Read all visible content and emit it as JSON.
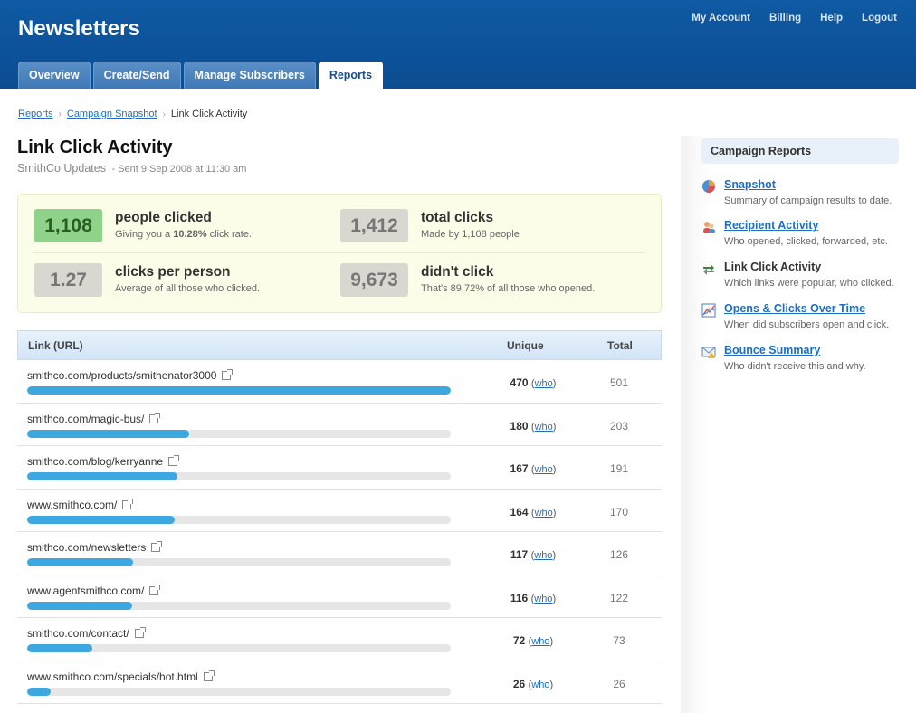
{
  "header": {
    "app_title": "Newsletters",
    "links": [
      "My Account",
      "Billing",
      "Help",
      "Logout"
    ],
    "tabs": [
      "Overview",
      "Create/Send",
      "Manage Subscribers",
      "Reports"
    ],
    "active_tab": "Reports"
  },
  "breadcrumb": {
    "items": [
      "Reports",
      "Campaign Snapshot"
    ],
    "current": "Link Click Activity"
  },
  "page": {
    "title": "Link Click Activity",
    "campaign": "SmithCo Updates",
    "sent": "- Sent 9 Sep 2008 at 11:30 am"
  },
  "stats": {
    "people_clicked": {
      "value": "1,108",
      "label": "people clicked",
      "desc_pre": "Giving you a ",
      "desc_bold": "10.28%",
      "desc_post": " click rate."
    },
    "total_clicks": {
      "value": "1,412",
      "label": "total clicks",
      "desc": "Made by 1,108 people"
    },
    "clicks_per_person": {
      "value": "1.27",
      "label": "clicks per person",
      "desc": "Average of all those who clicked."
    },
    "didnt_click": {
      "value": "9,673",
      "label": "didn't click",
      "desc": "That's 89.72% of all those who opened."
    }
  },
  "table": {
    "headers": {
      "link": "Link (URL)",
      "unique": "Unique",
      "total": "Total"
    },
    "who_label": "who",
    "max_unique": 470,
    "rows": [
      {
        "url": "smithco.com/products/smithenator3000",
        "unique": "470",
        "total": "501",
        "unique_num": 470
      },
      {
        "url": "smithco.com/magic-bus/",
        "unique": "180",
        "total": "203",
        "unique_num": 180
      },
      {
        "url": "smithco.com/blog/kerryanne",
        "unique": "167",
        "total": "191",
        "unique_num": 167
      },
      {
        "url": "www.smithco.com/",
        "unique": "164",
        "total": "170",
        "unique_num": 164
      },
      {
        "url": "smithco.com/newsletters",
        "unique": "117",
        "total": "126",
        "unique_num": 117
      },
      {
        "url": "www.agentsmithco.com/",
        "unique": "116",
        "total": "122",
        "unique_num": 116
      },
      {
        "url": "smithco.com/contact/",
        "unique": "72",
        "total": "73",
        "unique_num": 72
      },
      {
        "url": "www.smithco.com/specials/hot.html",
        "unique": "26",
        "total": "26",
        "unique_num": 26
      }
    ]
  },
  "sidebar": {
    "heading": "Campaign Reports",
    "items": [
      {
        "title": "Snapshot",
        "desc": "Summary of campaign results to date.",
        "icon": "pie-chart-icon",
        "link": true
      },
      {
        "title": "Recipient Activity",
        "desc": "Who opened, clicked, forwarded, etc.",
        "icon": "people-icon",
        "link": true
      },
      {
        "title": "Link Click Activity",
        "desc": "Which links were popular, who clicked.",
        "icon": "link-arrows-icon",
        "link": false
      },
      {
        "title": "Opens & Clicks Over Time",
        "desc": "When did subscribers open and click.",
        "icon": "line-graph-icon",
        "link": true
      },
      {
        "title": "Bounce Summary",
        "desc": "Who didn't receive this and why.",
        "icon": "envelope-warning-icon",
        "link": true
      }
    ]
  },
  "colors": {
    "header_blue": "#0f5aa3",
    "link_blue": "#1d6fc1",
    "bar_blue": "#3da8e0",
    "highlight_green": "#8fd38a"
  }
}
